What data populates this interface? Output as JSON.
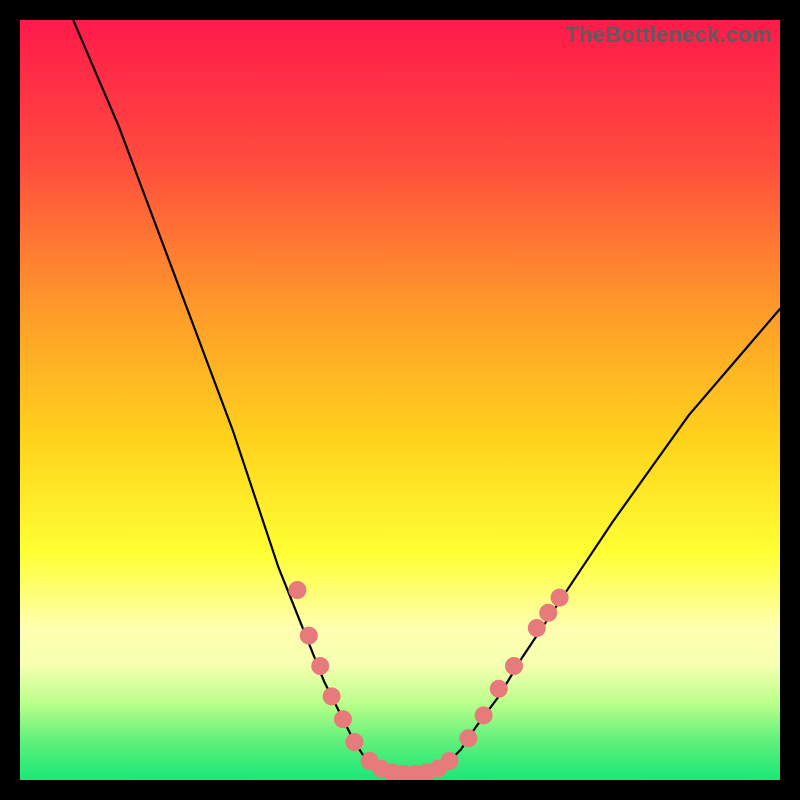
{
  "watermark": "TheBottleneck.com",
  "chart_data": {
    "type": "line",
    "title": "",
    "xlabel": "",
    "ylabel": "",
    "xlim": [
      0,
      100
    ],
    "ylim": [
      0,
      100
    ],
    "gradient_stops": [
      {
        "offset": 0,
        "color": "#ff1a4b"
      },
      {
        "offset": 18,
        "color": "#ff4a3e"
      },
      {
        "offset": 38,
        "color": "#ff9a2a"
      },
      {
        "offset": 55,
        "color": "#ffd21c"
      },
      {
        "offset": 70,
        "color": "#ffff33"
      },
      {
        "offset": 80,
        "color": "#ffffb0"
      },
      {
        "offset": 85,
        "color": "#f6ffb0"
      },
      {
        "offset": 90,
        "color": "#b8ff8a"
      },
      {
        "offset": 95,
        "color": "#5ef07a"
      },
      {
        "offset": 100,
        "color": "#19e876"
      }
    ],
    "series": [
      {
        "name": "left-curve",
        "x": [
          7,
          10,
          13,
          16,
          19,
          22,
          25,
          28,
          30,
          32,
          34,
          36,
          38,
          40,
          42,
          44,
          46
        ],
        "y": [
          100,
          93,
          86,
          78,
          70,
          62,
          54,
          46,
          40,
          34,
          28,
          23,
          18,
          13,
          9,
          5,
          2
        ]
      },
      {
        "name": "valley-floor",
        "x": [
          46,
          48,
          50,
          52,
          54,
          56
        ],
        "y": [
          2,
          1,
          0.5,
          0.5,
          1,
          2
        ]
      },
      {
        "name": "right-curve",
        "x": [
          56,
          58,
          60,
          63,
          66,
          70,
          74,
          78,
          83,
          88,
          94,
          100
        ],
        "y": [
          2,
          4,
          7,
          11,
          16,
          22,
          28,
          34,
          41,
          48,
          55,
          62
        ]
      }
    ],
    "markers": [
      {
        "x": 36.5,
        "y": 25
      },
      {
        "x": 38.0,
        "y": 19
      },
      {
        "x": 39.5,
        "y": 15
      },
      {
        "x": 41.0,
        "y": 11
      },
      {
        "x": 42.5,
        "y": 8
      },
      {
        "x": 44.0,
        "y": 5
      },
      {
        "x": 46.0,
        "y": 2.5
      },
      {
        "x": 47.5,
        "y": 1.5
      },
      {
        "x": 49.0,
        "y": 1.0
      },
      {
        "x": 50.5,
        "y": 0.8
      },
      {
        "x": 52.0,
        "y": 0.8
      },
      {
        "x": 53.5,
        "y": 1.0
      },
      {
        "x": 55.0,
        "y": 1.5
      },
      {
        "x": 56.5,
        "y": 2.5
      },
      {
        "x": 59.0,
        "y": 5.5
      },
      {
        "x": 61.0,
        "y": 8.5
      },
      {
        "x": 63.0,
        "y": 12
      },
      {
        "x": 65.0,
        "y": 15
      },
      {
        "x": 68.0,
        "y": 20
      },
      {
        "x": 69.5,
        "y": 22
      },
      {
        "x": 71.0,
        "y": 24
      }
    ],
    "marker_color": "#e77a7a",
    "marker_radius": 9,
    "curve_color": "#000000",
    "curve_width": 2.2
  }
}
